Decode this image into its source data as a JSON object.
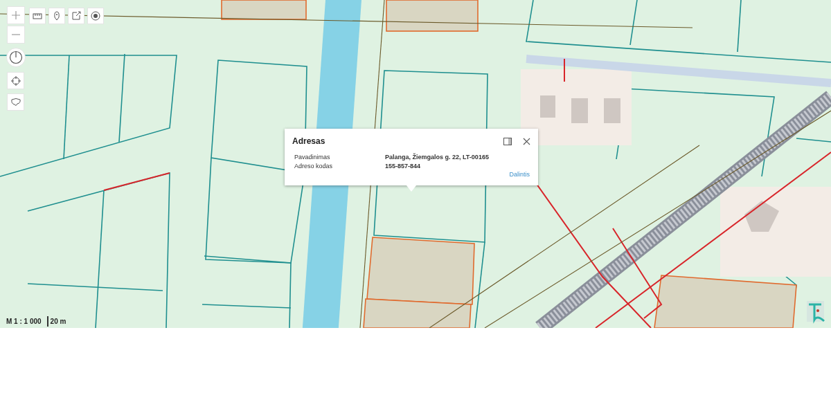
{
  "map": {
    "scale": {
      "ratio": "M 1 : 1 000",
      "distance": "20 m"
    }
  },
  "popup": {
    "title": "Adresas",
    "rows": [
      {
        "label": "Pavadinimas",
        "value": "Palanga, Žiemgalos g. 22, LT-00165"
      },
      {
        "label": "Adreso kodas",
        "value": "155-857-844"
      }
    ],
    "share_link": "Dalintis"
  }
}
